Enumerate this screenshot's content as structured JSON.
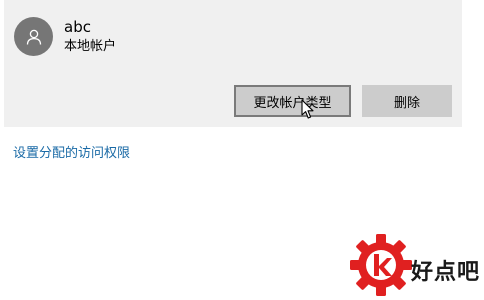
{
  "account": {
    "name": "abc",
    "type": "本地帐户",
    "avatar_icon": "person-icon",
    "card_background": "#f0f0f0"
  },
  "buttons": {
    "change_type_label": "更改帐户类型",
    "delete_label": "删除"
  },
  "links": {
    "assigned_access": "设置分配的访问权限",
    "link_color": "#1a6aa6"
  },
  "watermark": {
    "text": "好点吧",
    "logo_icon": "red-gear-logo-icon",
    "logo_color": "#e02020"
  }
}
